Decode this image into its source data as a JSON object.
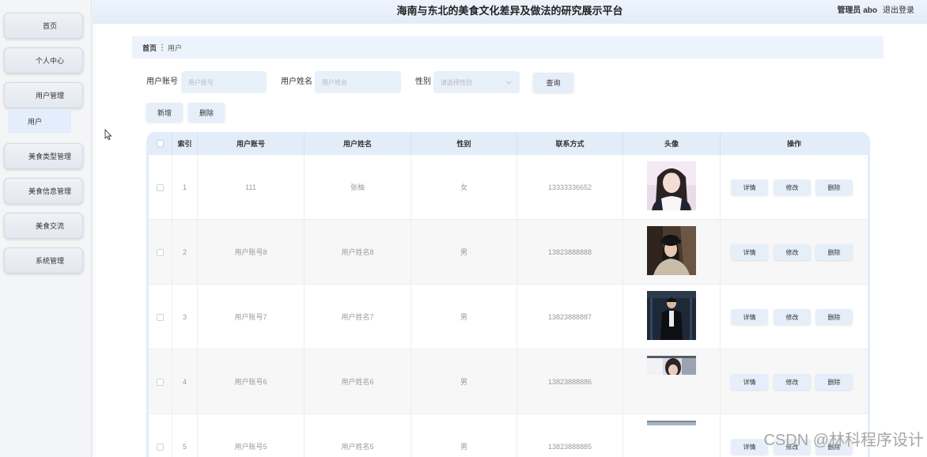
{
  "header": {
    "title": "海南与东北的美食文化差异及做法的研究展示平台",
    "user_label": "管理员 abo",
    "logout_label": "退出登录"
  },
  "sidebar": {
    "items": [
      {
        "label": "首页"
      },
      {
        "label": "个人中心"
      },
      {
        "label": "用户管理",
        "expanded": true,
        "children": [
          {
            "label": "用户",
            "active": true
          }
        ]
      },
      {
        "label": "美食类型管理"
      },
      {
        "label": "美食信息管理"
      },
      {
        "label": "美食交流"
      },
      {
        "label": "系统管理"
      }
    ]
  },
  "breadcrumb": {
    "items": [
      "首页",
      "用户"
    ],
    "separator_icon": "breadcrumb-separator-icon"
  },
  "search": {
    "account": {
      "label": "用户账号",
      "placeholder": "用户账号",
      "value": ""
    },
    "name": {
      "label": "用户姓名",
      "placeholder": "用户姓名",
      "value": ""
    },
    "gender": {
      "label": "性别",
      "placeholder": "请选择性别",
      "value": "",
      "icon": "chevron-down-icon"
    },
    "query_label": "查询"
  },
  "toolbar": {
    "add_label": "新增",
    "delete_label": "删除"
  },
  "table": {
    "columns": {
      "index": "索引",
      "account": "用户账号",
      "name": "用户姓名",
      "gender": "性别",
      "phone": "联系方式",
      "avatar": "头像",
      "actions": "操作"
    },
    "row_actions": [
      "详情",
      "修改",
      "删除"
    ],
    "rows": [
      {
        "index": "1",
        "account": "111",
        "name": "张柚",
        "gender": "女",
        "phone": "13333336652",
        "checked": false
      },
      {
        "index": "2",
        "account": "用户账号8",
        "name": "用户姓名8",
        "gender": "男",
        "phone": "13823888888",
        "checked": false
      },
      {
        "index": "3",
        "account": "用户账号7",
        "name": "用户姓名7",
        "gender": "男",
        "phone": "13823888887",
        "checked": false
      },
      {
        "index": "4",
        "account": "用户账号6",
        "name": "用户姓名6",
        "gender": "男",
        "phone": "13823888886",
        "checked": false
      },
      {
        "index": "5",
        "account": "用户账号5",
        "name": "用户姓名5",
        "gender": "男",
        "phone": "13823888885",
        "checked": false
      }
    ]
  },
  "watermark": "CSDN @林科程序设计",
  "cursor": {
    "icon": "mouse-pointer-icon"
  },
  "colors": {
    "header_bg": "#eaf1fb",
    "accent_light": "#e6eefa",
    "table_header_bg": "#e3ecf9",
    "row_alt_bg": "#f7f7f7",
    "text_muted": "#9a9a9a"
  }
}
